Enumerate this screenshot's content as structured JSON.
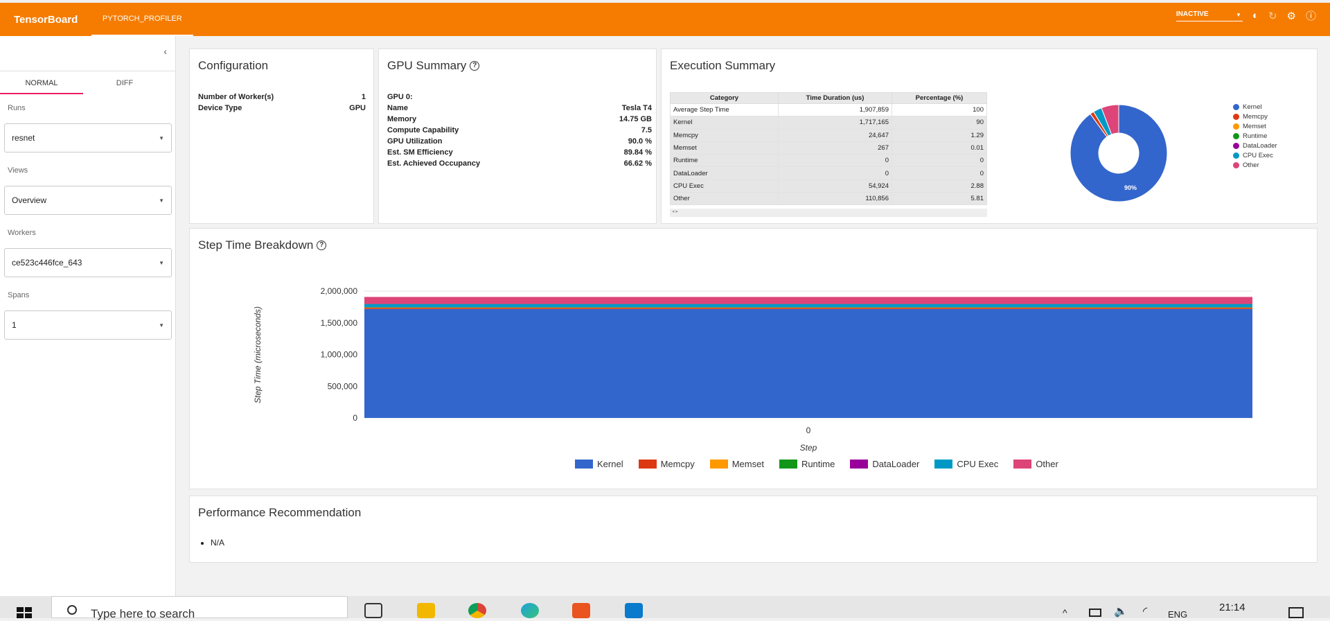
{
  "topbar": {
    "brand": "TensorBoard",
    "active_tab": "PYTORCH_PROFILER",
    "status_select": "INACTIVE"
  },
  "sidebar": {
    "modes": [
      "NORMAL",
      "DIFF"
    ],
    "runs_label": "Runs",
    "runs_value": "resnet",
    "views_label": "Views",
    "views_value": "Overview",
    "workers_label": "Workers",
    "workers_value": "ce523c446fce_643",
    "spans_label": "Spans",
    "spans_value": "1"
  },
  "configuration": {
    "title": "Configuration",
    "rows": [
      {
        "key": "Number of Worker(s)",
        "value": "1"
      },
      {
        "key": "Device Type",
        "value": "GPU"
      }
    ]
  },
  "gpu_summary": {
    "title": "GPU Summary",
    "gpu_label": "GPU 0:",
    "rows": [
      {
        "key": "Name",
        "value": "Tesla T4"
      },
      {
        "key": "Memory",
        "value": "14.75 GB"
      },
      {
        "key": "Compute Capability",
        "value": "7.5"
      },
      {
        "key": "GPU Utilization",
        "value": "90.0 %"
      },
      {
        "key": "Est. SM Efficiency",
        "value": "89.84 %"
      },
      {
        "key": "Est. Achieved Occupancy",
        "value": "66.62 %"
      }
    ]
  },
  "execution_summary": {
    "title": "Execution Summary",
    "headers": [
      "Category",
      "Time Duration (us)",
      "Percentage (%)"
    ],
    "rows": [
      [
        "Average Step Time",
        "1,907,859",
        "100"
      ],
      [
        "Kernel",
        "1,717,165",
        "90"
      ],
      [
        "Memcpy",
        "24,647",
        "1.29"
      ],
      [
        "Memset",
        "267",
        "0.01"
      ],
      [
        "Runtime",
        "0",
        "0"
      ],
      [
        "DataLoader",
        "0",
        "0"
      ],
      [
        "CPU Exec",
        "54,924",
        "2.88"
      ],
      [
        "Other",
        "110,856",
        "5.81"
      ]
    ],
    "scroll_arrows": "◂ ▸",
    "pie_label": "90%"
  },
  "step_time": {
    "title": "Step Time Breakdown"
  },
  "recommendation": {
    "title": "Performance Recommendation",
    "items": [
      "N/A"
    ]
  },
  "taskbar": {
    "search_placeholder": "Type here to search",
    "lang": "ENG",
    "time": "21:14"
  },
  "colors": {
    "accent": "#f57c00",
    "kernel": "#3366cc",
    "memcpy": "#dc3912",
    "memset": "#ff9900",
    "runtime": "#109618",
    "dataloader": "#990099",
    "cpu_exec": "#0099c6",
    "other": "#dd4477"
  },
  "chart_data": [
    {
      "type": "pie",
      "categories": [
        "Kernel",
        "Memcpy",
        "Memset",
        "Runtime",
        "DataLoader",
        "CPU Exec",
        "Other"
      ],
      "values": [
        90,
        1.29,
        0.01,
        0,
        0,
        2.88,
        5.81
      ],
      "data_labels": [
        "90%"
      ],
      "legend": "right"
    },
    {
      "type": "area",
      "title": "",
      "xlabel": "Step",
      "ylabel": "Step Time (microseconds)",
      "categories": [
        "0"
      ],
      "ylim": [
        0,
        2000000
      ],
      "yticks": [
        "0",
        "500,000",
        "1,000,000",
        "1,500,000",
        "2,000,000"
      ],
      "series": [
        {
          "name": "Kernel",
          "values": [
            1717165
          ]
        },
        {
          "name": "Memcpy",
          "values": [
            24647
          ]
        },
        {
          "name": "Memset",
          "values": [
            267
          ]
        },
        {
          "name": "Runtime",
          "values": [
            0
          ]
        },
        {
          "name": "DataLoader",
          "values": [
            0
          ]
        },
        {
          "name": "CPU Exec",
          "values": [
            54924
          ]
        },
        {
          "name": "Other",
          "values": [
            110856
          ]
        }
      ],
      "legend": "bottom",
      "grid": true
    }
  ]
}
